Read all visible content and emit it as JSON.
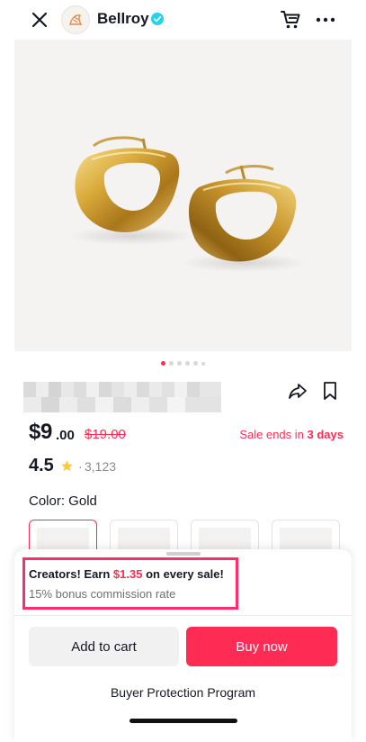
{
  "header": {
    "shop_name": "Bellroy",
    "icons": [
      "close-icon",
      "shop-logo-icon",
      "verified-badge-icon",
      "cart-icon",
      "more-icon"
    ]
  },
  "gallery": {
    "image_count": 6,
    "active_index": 0
  },
  "product": {
    "price_whole": "$9",
    "price_cents": ".00",
    "original_price": "$19.00",
    "sale_prefix": "Sale ends in ",
    "sale_days": "3 days",
    "rating": "4.5",
    "rating_separator": "·",
    "review_count": "3,123",
    "color_label": "Color: Gold",
    "swatch_count": 4
  },
  "creator_promo": {
    "title_prefix": "Creators! Earn ",
    "amount": "$1.35",
    "title_suffix": " on every sale!",
    "subtitle": "15% bonus commission rate"
  },
  "actions": {
    "add_to_cart": "Add to cart",
    "buy_now": "Buy now",
    "protection": "Buyer Protection Program"
  },
  "colors": {
    "accent": "#fe2c55",
    "verified": "#20d5ec",
    "highlight_border": "#ff2d6c",
    "gold": "#c99a2c"
  }
}
